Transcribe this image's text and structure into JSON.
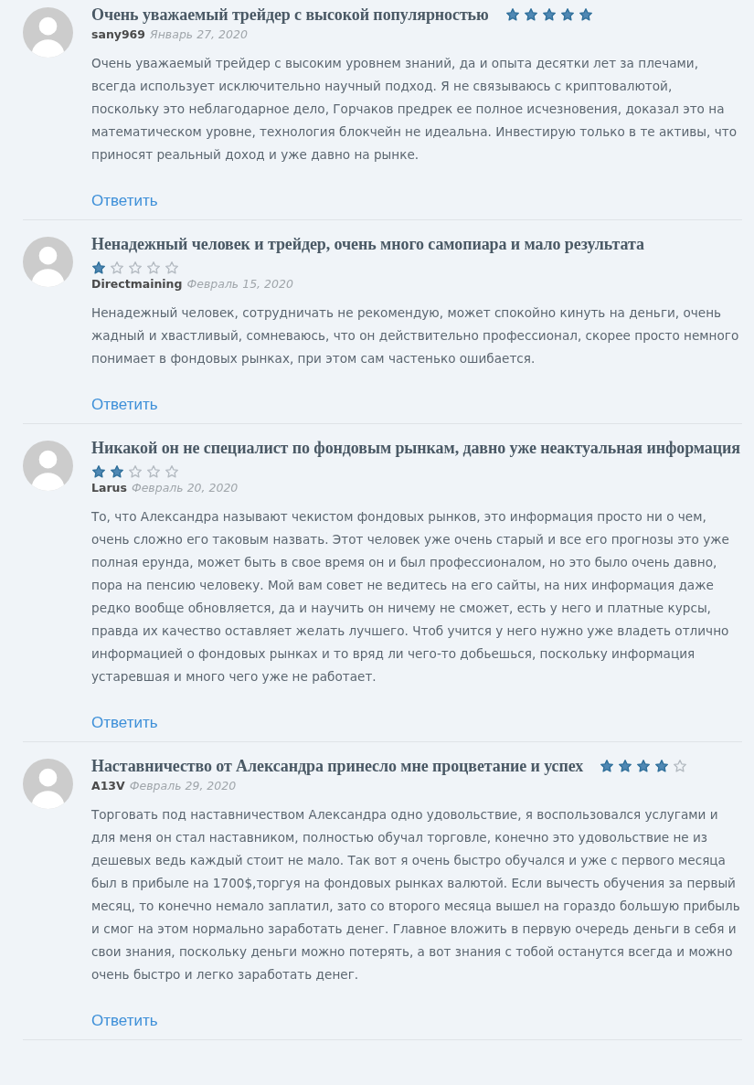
{
  "reviews": [
    {
      "title": "Очень уважаемый трейдер с высокой популярностью",
      "stars": 5,
      "author": "sany969",
      "date": "Январь 27, 2020",
      "text": "Очень уважаемый трейдер с высоким уровнем знаний, да и опыта десятки лет за плечами, всегда использует исключительно научный подход. Я не связываюсь с криптовалютой, поскольку это неблагодарное дело, Горчаков предрек ее полное исчезновения, доказал это на математическом уровне, технология блокчейн не идеальна. Инвестирую только в те активы, что приносят реальный доход и уже давно на рынке.",
      "reply": "Ответить"
    },
    {
      "title": "Ненадежный человек и трейдер, очень много самопиара и мало результата",
      "stars": 1,
      "author": "Directmaining",
      "date": "Февраль 15, 2020",
      "text": "Ненадежный человек, сотрудничать не рекомендую, может спокойно кинуть на деньги, очень жадный и хвастливый, сомневаюсь, что он действительно профессионал, скорее просто немного понимает в фондовых рынках, при этом сам частенько ошибается.",
      "reply": "Ответить"
    },
    {
      "title": "Никакой он не специалист по фондовым рынкам, давно уже неактуальная информация",
      "stars": 2,
      "author": "Larus",
      "date": "Февраль 20, 2020",
      "text": "То, что Александра называют чекистом фондовых рынков, это информация просто ни о чем, очень сложно его таковым назвать. Этот человек уже очень старый и все его прогнозы это уже полная ерунда, может быть в свое время он и был профессионалом, но это было очень давно, пора на пенсию человеку. Мой вам совет не ведитесь на его сайты, на них информация даже редко вообще обновляется, да и научить он ничему не сможет, есть у него и платные курсы, правда их качество оставляет желать лучшего. Чтоб учится у него нужно уже владеть отлично информацией о фондовых рынках и то вряд ли чего-то добьешься, поскольку информация устаревшая и много чего уже не работает.",
      "reply": "Ответить"
    },
    {
      "title": "Наставничество от Александра принесло мне процветание и успех",
      "stars": 4,
      "author": "A13V",
      "date": "Февраль 29, 2020",
      "text": "Торговать под наставничеством Александра одно удовольствие, я воспользовался услугами и для меня он стал наставником, полностью обучал торговле, конечно это удовольствие не из дешевых ведь каждый стоит не мало. Так вот я очень быстро обучался и уже с первого месяца был в прибыле на 1700$,торгуя на фондовых рынках валютой. Если вычесть обучения за первый месяц, то конечно немало заплатил, зато со второго месяца вышел на гораздо большую прибыль и смог на этом нормально заработать денег. Главное вложить в первую очередь деньги в себя и свои знания, поскольку деньги можно потерять, а вот знания с тобой останутся всегда и можно очень быстро и легко заработать денег.",
      "reply": "Ответить"
    }
  ]
}
